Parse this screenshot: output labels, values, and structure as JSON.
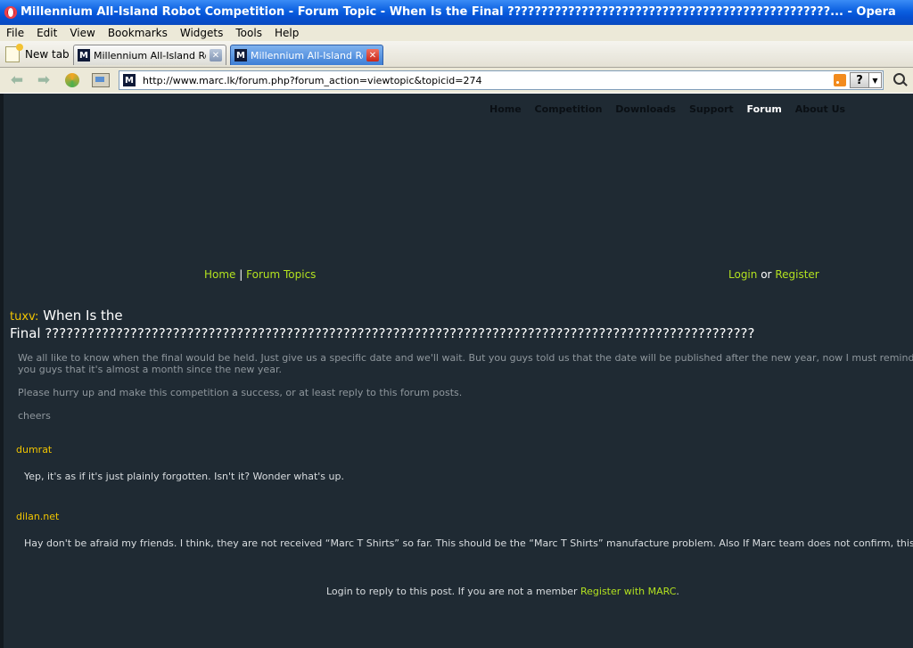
{
  "window": {
    "title": "Millennium All-Island Robot Competition - Forum Topic - When Is the Final ????????????????????????????????????????????????... - Opera"
  },
  "menu": [
    "File",
    "Edit",
    "View",
    "Bookmarks",
    "Widgets",
    "Tools",
    "Help"
  ],
  "tabs": {
    "new_tab_label": "New tab",
    "items": [
      {
        "label": "Millennium All-Island Rob…",
        "active": false
      },
      {
        "label": "Millennium All-Island Rob…",
        "active": true
      }
    ]
  },
  "address": {
    "url": "http://www.marc.lk/forum.php?forum_action=viewtopic&topicid=274"
  },
  "site_nav": [
    "Home",
    "Competition",
    "Downloads",
    "Support",
    "Forum",
    "About Us"
  ],
  "site_nav_active": "Forum",
  "breadcrumb": {
    "home": "Home",
    "separator": "|",
    "topics": "Forum Topics"
  },
  "auth": {
    "login": "Login",
    "or": "or",
    "register": "Register"
  },
  "topic": {
    "author": "tuxv:",
    "title_line1": "When Is the",
    "title_line2": "Final ????????????????????????????????????????????????????????????????????????????????????????????????????",
    "body": [
      "We all like to know when the final would be held. Just give us a specific date and we'll wait. But you guys told us that the date will be published after the new year, now I must remind you guys that it's almost a month since the new year.",
      "Please hurry up and make this competition a success, or at least reply to this forum posts.",
      "cheers"
    ]
  },
  "replies": [
    {
      "author": "dumrat",
      "text": "Yep, it's as if it's just plainly forgotten. Isn't it? Wonder what's up."
    },
    {
      "author": "dilan.net",
      "text": "Hay don't be afraid my friends. I think, they are not received “Marc T Shirts” so far. This should be the “Marc T Shirts” manufacture problem. Also If Marc team does not confirm, this should be the trouble :-)))"
    }
  ],
  "footer": {
    "text": "Login to reply to this post. If you are not a member",
    "link": "Register with MARC",
    "end": "."
  },
  "colors": {
    "page_bg": "#1f2a33",
    "link_green": "#b3e21f",
    "author_yellow": "#f0c400"
  }
}
